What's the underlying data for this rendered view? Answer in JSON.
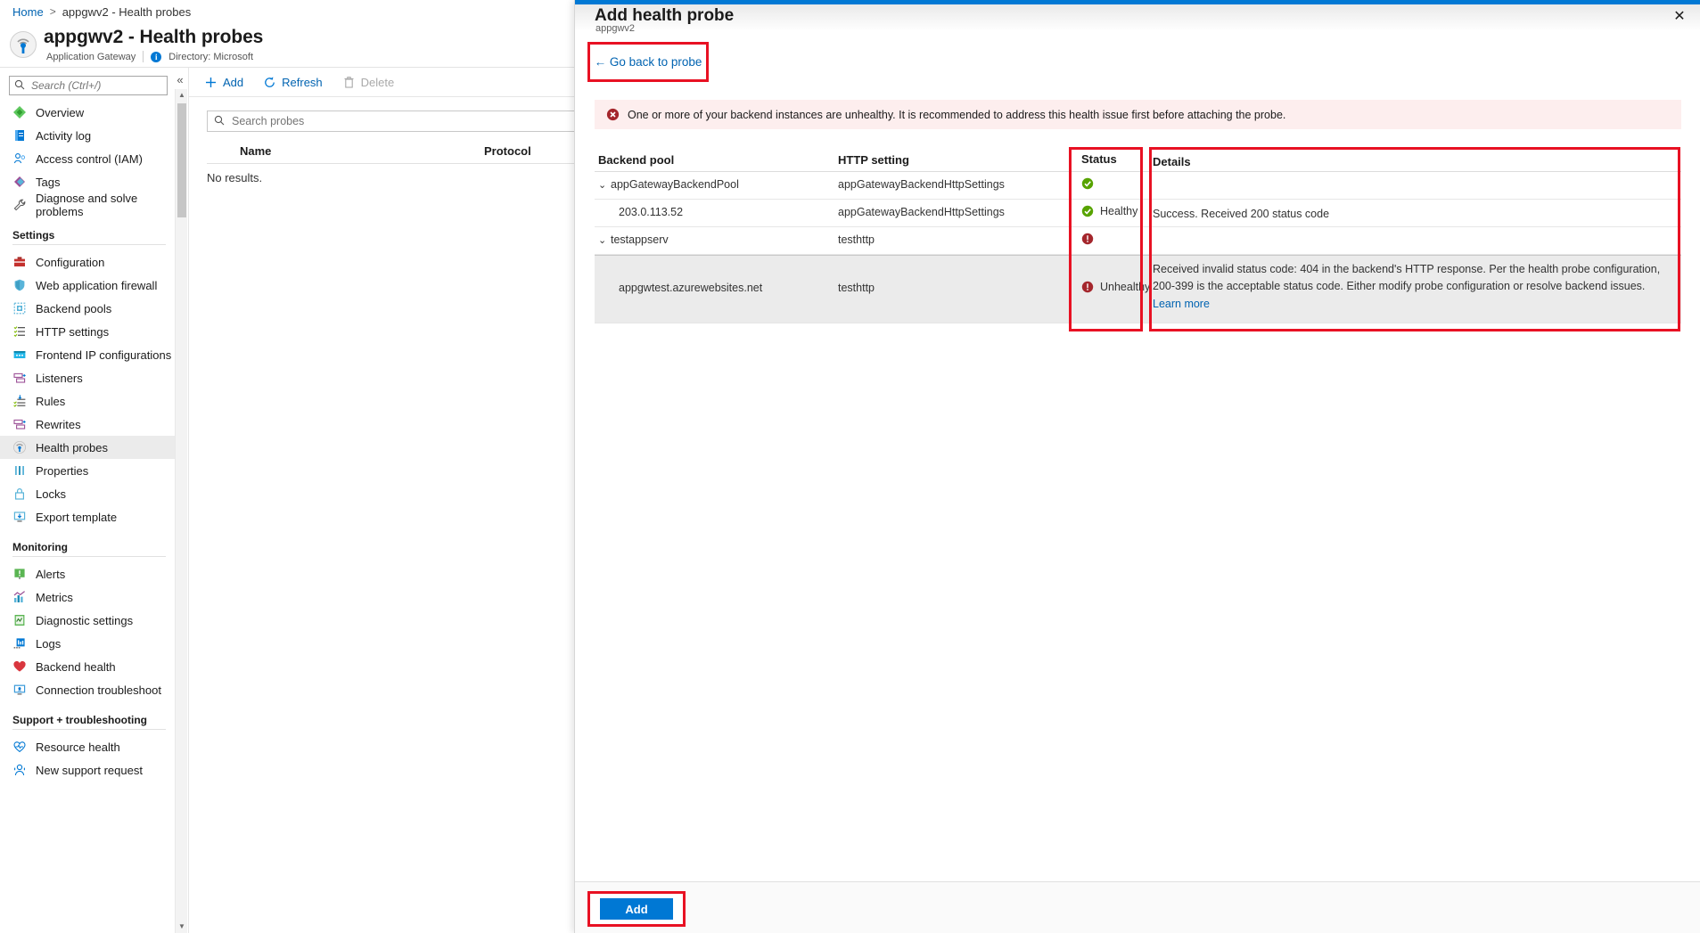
{
  "breadcrumb": {
    "home": "Home",
    "separator": ">",
    "current": "appgwv2 - Health probes"
  },
  "resource": {
    "title": "appgwv2 - Health probes",
    "type": "Application Gateway",
    "directory": "Directory: Microsoft",
    "icon": "application-gateway-icon"
  },
  "nav_search": {
    "placeholder": "Search (Ctrl+/)",
    "icon": "search-icon"
  },
  "collapse": {
    "glyph": "«"
  },
  "sidebar": {
    "items": [
      {
        "label": "Overview",
        "icon": "overview-icon",
        "selected": false
      },
      {
        "label": "Activity log",
        "icon": "activity-log-icon",
        "selected": false
      },
      {
        "label": "Access control (IAM)",
        "icon": "access-control-icon",
        "selected": false
      },
      {
        "label": "Tags",
        "icon": "tags-icon",
        "selected": false
      },
      {
        "label": "Diagnose and solve problems",
        "icon": "wrench-icon",
        "selected": false
      }
    ],
    "groups": [
      {
        "title": "Settings",
        "items": [
          {
            "label": "Configuration",
            "icon": "configuration-icon",
            "selected": false
          },
          {
            "label": "Web application firewall",
            "icon": "shield-icon",
            "selected": false
          },
          {
            "label": "Backend pools",
            "icon": "backend-pools-icon",
            "selected": false
          },
          {
            "label": "HTTP settings",
            "icon": "http-settings-icon",
            "selected": false
          },
          {
            "label": "Frontend IP configurations",
            "icon": "frontend-ip-icon",
            "selected": false
          },
          {
            "label": "Listeners",
            "icon": "listeners-icon",
            "selected": false
          },
          {
            "label": "Rules",
            "icon": "rules-icon",
            "selected": false
          },
          {
            "label": "Rewrites",
            "icon": "rewrites-icon",
            "selected": false
          },
          {
            "label": "Health probes",
            "icon": "health-probes-icon",
            "selected": true
          },
          {
            "label": "Properties",
            "icon": "properties-icon",
            "selected": false
          },
          {
            "label": "Locks",
            "icon": "lock-icon",
            "selected": false
          },
          {
            "label": "Export template",
            "icon": "export-template-icon",
            "selected": false
          }
        ]
      },
      {
        "title": "Monitoring",
        "items": [
          {
            "label": "Alerts",
            "icon": "alerts-icon",
            "selected": false
          },
          {
            "label": "Metrics",
            "icon": "metrics-icon",
            "selected": false
          },
          {
            "label": "Diagnostic settings",
            "icon": "diagnostic-settings-icon",
            "selected": false
          },
          {
            "label": "Logs",
            "icon": "logs-icon",
            "selected": false
          },
          {
            "label": "Backend health",
            "icon": "heart-icon",
            "selected": false
          },
          {
            "label": "Connection troubleshoot",
            "icon": "connection-troubleshoot-icon",
            "selected": false
          }
        ]
      },
      {
        "title": "Support + troubleshooting",
        "items": [
          {
            "label": "Resource health",
            "icon": "resource-health-icon",
            "selected": false
          },
          {
            "label": "New support request",
            "icon": "support-request-icon",
            "selected": false
          }
        ]
      }
    ]
  },
  "commandbar": {
    "add": "Add",
    "refresh": "Refresh",
    "delete": "Delete",
    "add_icon": "plus-icon",
    "refresh_icon": "refresh-icon",
    "delete_icon": "trash-icon"
  },
  "probes_list": {
    "search_placeholder": "Search probes",
    "search_icon": "search-icon",
    "columns": {
      "name": "Name",
      "protocol": "Protocol"
    },
    "empty_text": "No results."
  },
  "blade": {
    "title": "Add health probe",
    "subtitle": "appgwv2",
    "close_icon": "close-icon",
    "go_back": "← Go back to probe",
    "alert": {
      "icon": "error-circle-icon",
      "text": "One or more of your backend instances are unhealthy. It is recommended to address this health issue first before attaching the probe."
    },
    "table": {
      "columns": {
        "backend_pool": "Backend pool",
        "http_setting": "HTTP setting",
        "status": "Status",
        "details": "Details"
      },
      "rows": [
        {
          "pool": "appGatewayBackendPool",
          "is_group": true,
          "chevron": "⌄",
          "http_setting": "appGatewayBackendHttpSettings",
          "status_icon": "healthy-icon",
          "status_label": "",
          "details": "",
          "learn_more": "",
          "highlighted": false
        },
        {
          "pool": "203.0.113.52",
          "is_group": false,
          "chevron": "",
          "http_setting": "appGatewayBackendHttpSettings",
          "status_icon": "healthy-icon",
          "status_label": "Healthy",
          "details": "Success. Received 200 status code",
          "learn_more": "",
          "highlighted": false
        },
        {
          "pool": "testappserv",
          "is_group": true,
          "chevron": "⌄",
          "http_setting": "testhttp",
          "status_icon": "unhealthy-icon",
          "status_label": "",
          "details": "",
          "learn_more": "",
          "highlighted": false
        },
        {
          "pool": "appgwtest.azurewebsites.net",
          "is_group": false,
          "chevron": "",
          "http_setting": "testhttp",
          "status_icon": "unhealthy-icon",
          "status_label": "Unhealthy",
          "details": "Received invalid status code: 404 in the backend's HTTP response. Per the health probe configuration, 200-399 is the acceptable status code. Either modify probe configuration or resolve backend issues.",
          "learn_more": "Learn more",
          "highlighted": true
        }
      ]
    },
    "footer": {
      "add_label": "Add"
    }
  },
  "colors": {
    "accent": "#0078d4",
    "link": "#0063b1",
    "highlight_box": "#e81123",
    "healthy": "#57a300",
    "unhealthy": "#a4262c",
    "alert_bg": "#fdeeee",
    "selected_row": "#ebebeb"
  }
}
